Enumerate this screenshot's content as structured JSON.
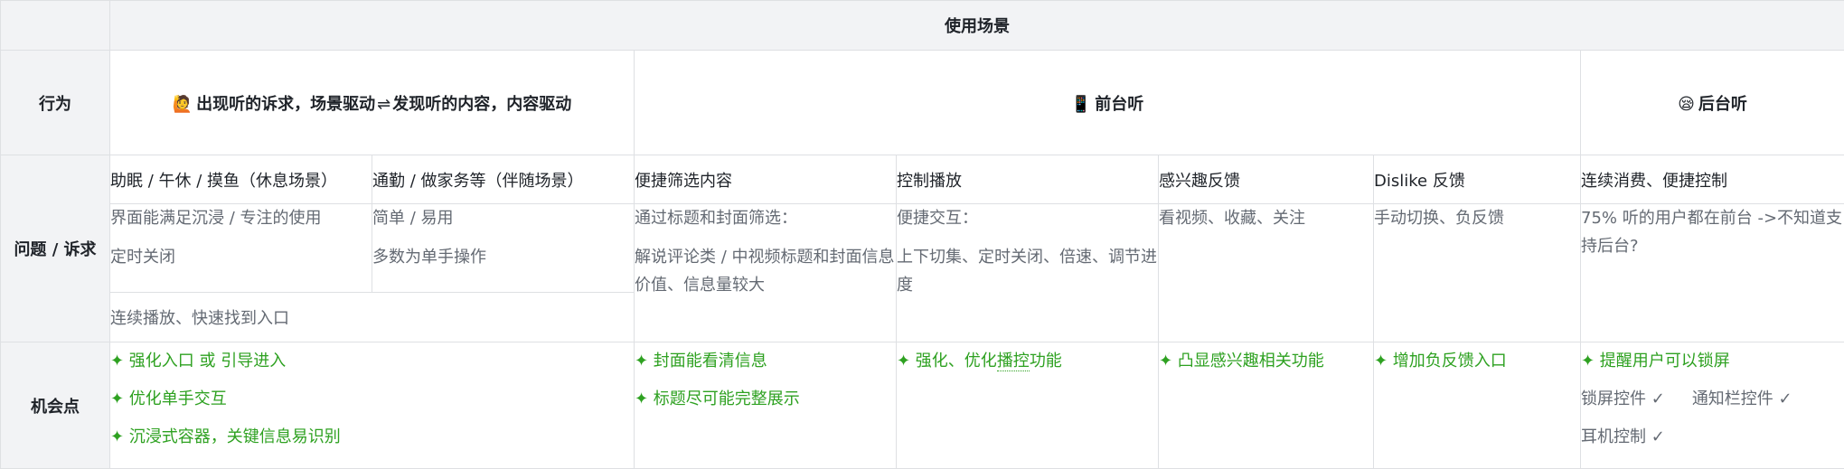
{
  "header": {
    "usage_scenario": "使用场景"
  },
  "rows": {
    "behavior": "行为",
    "issues": "问题 / 诉求",
    "opportunities": "机会点"
  },
  "behaviors": {
    "scene": {
      "emoji": "🙋",
      "left": "出现听的诉求，场景驱动",
      "arrow": "⇌",
      "right": "发现听的内容，内容驱动"
    },
    "foreground": {
      "emoji": "📱",
      "label": "前台听"
    },
    "background": {
      "emoji": "😪",
      "label": "后台听"
    }
  },
  "issues": {
    "rest": {
      "title": "助眠 / 午休 / 摸鱼（休息场景）",
      "lines": [
        "界面能满足沉浸 / 专注的使用",
        "定时关闭"
      ]
    },
    "companion": {
      "title": "通勤 / 做家务等（伴随场景）",
      "lines": [
        "简单 / 易用",
        "多数为单手操作"
      ]
    },
    "shared_foot": "连续播放、快速找到入口",
    "filter": {
      "title": "便捷筛选内容",
      "intro": "通过标题和封面筛选：",
      "detail": "解说评论类 / 中视频标题和封面信息价值、信息量较大"
    },
    "control": {
      "title": "控制播放",
      "intro": "便捷交互：",
      "detail": "上下切集、定时关闭、倍速、调节进度"
    },
    "interest": {
      "title": "感兴趣反馈",
      "body": "看视频、收藏、关注"
    },
    "dislike": {
      "title": "Dislike 反馈",
      "body": "手动切换、负反馈"
    },
    "background": {
      "title": "连续消费、便捷控制",
      "body": "75% 听的用户都在前台 ->不知道支持后台?"
    }
  },
  "opportunities": {
    "scene": [
      "✦ 强化入口 或 引导进入",
      "✦ 优化单手交互",
      "✦ 沉浸式容器，关键信息易识别"
    ],
    "filter": [
      "✦ 封面能看清信息",
      "✦ 标题尽可能完整展示"
    ],
    "control": {
      "prefix": "✦ 强化、优化",
      "underlined": "播控",
      "suffix": "功能"
    },
    "interest": [
      "✦ 凸显感兴趣相关功能"
    ],
    "dislike": [
      "✦ 增加负反馈入口"
    ],
    "background": {
      "highlight": "✦ 提醒用户可以锁屏",
      "lockscreen": "锁屏控件 ✓",
      "notification": "通知栏控件 ✓",
      "earphone": "耳机控制 ✓"
    }
  },
  "colors": {
    "accent_green": "#2ea121",
    "header_bg": "#f2f3f5",
    "border": "#dee0e3",
    "muted_text": "#646a73"
  }
}
